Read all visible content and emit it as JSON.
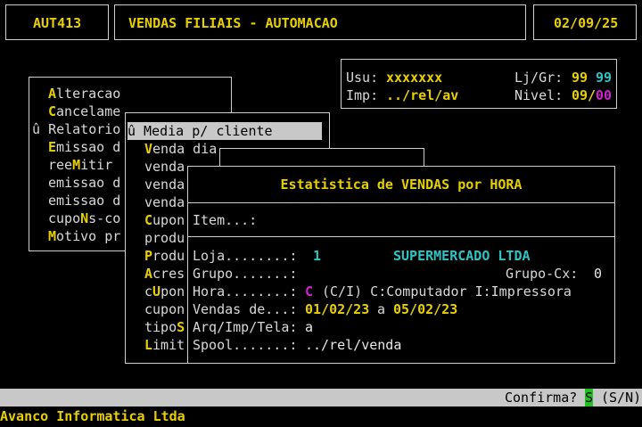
{
  "header": {
    "code": "AUT413",
    "title": "VENDAS FILIAIS - AUTOMACAO",
    "date": "02/09/25"
  },
  "user_panel": {
    "usu_label": "Usu:",
    "usu_value": "xxxxxxx",
    "lj_label": "Lj/Gr:",
    "lj_value1": "99",
    "lj_value2": "99",
    "imp_label": "Imp:",
    "imp_value": "../rel/av",
    "nivel_label": "Nivel:",
    "nivel_value1": "09/",
    "nivel_value2": "00"
  },
  "main_menu": {
    "items": [
      {
        "hot": "A",
        "rest": "lteracao"
      },
      {
        "hot": "C",
        "rest": "ancelame"
      },
      {
        "prefix": "û ",
        "hot": "",
        "rest": "Relatorio"
      },
      {
        "hot": "E",
        "rest": "missao d"
      },
      {
        "pre": "ree",
        "hot": "M",
        "rest": "itir"
      },
      {
        "pre": "",
        "hot": "",
        "rest": "emissao d"
      },
      {
        "pre": "",
        "hot": "",
        "rest": "emissao d"
      },
      {
        "pre": "cupo",
        "hot": "N",
        "rest": "s-co"
      },
      {
        "hot": "M",
        "rest": "otivo pr"
      }
    ]
  },
  "sub_menu": {
    "items": [
      {
        "text": "û Media p/ cliente",
        "selected": true
      },
      {
        "hot": "V",
        "rest": "enda dia"
      },
      {
        "hot": "",
        "rest": "venda"
      },
      {
        "hot": "",
        "rest": "venda"
      },
      {
        "hot": "",
        "rest": "venda"
      },
      {
        "hot": "C",
        "rest": "upon"
      },
      {
        "hot": "",
        "rest": "produ"
      },
      {
        "hot": "P",
        "rest": "rodu"
      },
      {
        "hot": "A",
        "rest": "cres"
      },
      {
        "pre": "c",
        "hot": "U",
        "rest": "pon"
      },
      {
        "hot": "",
        "rest": "cupon"
      },
      {
        "pre": "tipo",
        "hot": "S",
        "rest": ""
      },
      {
        "hot": "L",
        "rest": "imit"
      }
    ]
  },
  "dialog": {
    "title": "Estatistica de VENDAS por HORA",
    "item_label": "Item...:",
    "loja_label": "Loja........:",
    "loja_value": "1",
    "loja_name": "SUPERMERCADO LTDA",
    "grupo_label": "Grupo.......:",
    "grupocx_label": "Grupo-Cx:",
    "grupocx_value": "0",
    "hora_label": "Hora........:",
    "hora_value": "C",
    "hora_options": "(C/I) C:Computador I:Impressora",
    "vendas_label": "Vendas de...:",
    "vendas_from": "01/02/23",
    "vendas_a": "a",
    "vendas_to": "05/02/23",
    "arq_label": "Arq/Imp/Tela:",
    "arq_value": "a",
    "spool_label": "Spool.......:",
    "spool_value": "../rel/venda"
  },
  "statusbar": {
    "confirm_label": "Confirma?",
    "confirm_value": "S",
    "confirm_options": "(S/N)"
  },
  "footer": {
    "company": "Avanco Informatica Ltda"
  },
  "colors": {
    "yellow": "#e8d000",
    "cyan": "#2fc4c4",
    "magenta": "#d020d0",
    "status_bg": "#c8c8c8",
    "confirm_green": "#20c020"
  }
}
